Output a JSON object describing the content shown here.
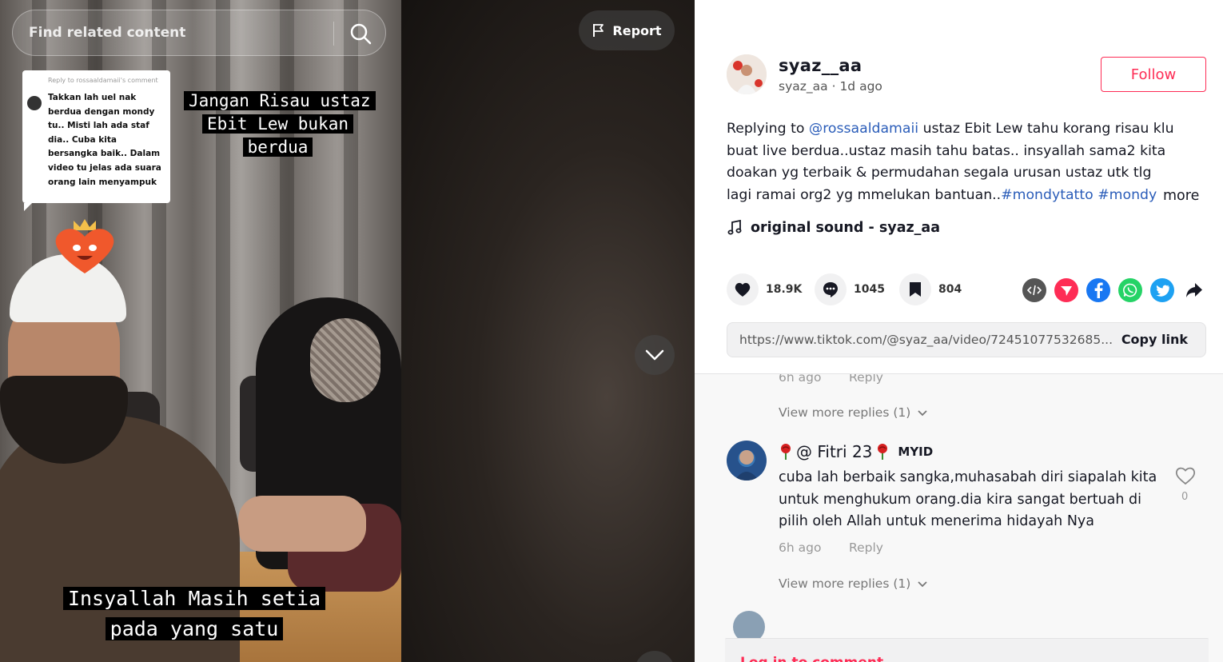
{
  "video": {
    "search_placeholder": "Find related content",
    "report_label": "Report",
    "reply_bubble": {
      "title": "Reply to rossaaldamaii's comment",
      "text": "Takkan lah uel nak berdua dengan mondy tu.. Misti lah ada staf dia.. Cuba kita bersangka baik.. Dalam video tu jelas ada suara orang lain menyampuk"
    },
    "caption_top": "Jangan Risau ustaz Ebit Lew bukan berdua",
    "caption_bottom": "Insyallah Masih setia pada yang satu"
  },
  "author": {
    "display_name": "syaz__aa",
    "username": "syaz_aa",
    "time_ago": "1d ago",
    "follow_label": "Follow"
  },
  "description": {
    "prefix": "Replying to ",
    "mention": "@rossaaldamaii",
    "body": " ustaz Ebit Lew tahu korang risau klu buat live berdua..ustaz masih tahu batas.. insyallah sama2 kita doakan yg terbaik & permudahan segala urusan ustaz utk tlg lagi ramai org2 yg mmelukan bantuan..",
    "hashtag1": "#mondytatto",
    "hashtag2": "#mondy",
    "more_label": "more"
  },
  "music": {
    "title": "original sound - syaz_aa"
  },
  "stats": {
    "likes": "18.9K",
    "comments": "1045",
    "saves": "804"
  },
  "share": {
    "icons": [
      "embed-icon",
      "send-to-friends-icon",
      "facebook-icon",
      "whatsapp-icon",
      "twitter-icon",
      "share-arrow-icon"
    ],
    "colors": {
      "embed": "#555555",
      "send": "#fe2c55",
      "facebook": "#1877f2",
      "whatsapp": "#25d366",
      "twitter": "#1da1f2"
    }
  },
  "link": {
    "url": "https://www.tiktok.com/@syaz_aa/video/72451077532685...",
    "copy_label": "Copy link"
  },
  "comments": {
    "c1": {
      "time": "6h ago",
      "reply_label": "Reply",
      "view_more": "View more replies (1)"
    },
    "c2": {
      "user": "@ Fitri 23",
      "tag": "MYID",
      "text": "cuba lah berbaik sangka,muhasabah diri siapalah kita untuk menghukum orang.dia kira sangat bertuah di pilih oleh Allah untuk menerima hidayah Nya",
      "time": "6h ago",
      "reply_label": "Reply",
      "like_count": "0",
      "view_more": "View more replies (1)"
    }
  },
  "login": {
    "label": "Log in to comment"
  },
  "colors": {
    "accent": "#fe2c55",
    "link": "#2b5db9"
  }
}
